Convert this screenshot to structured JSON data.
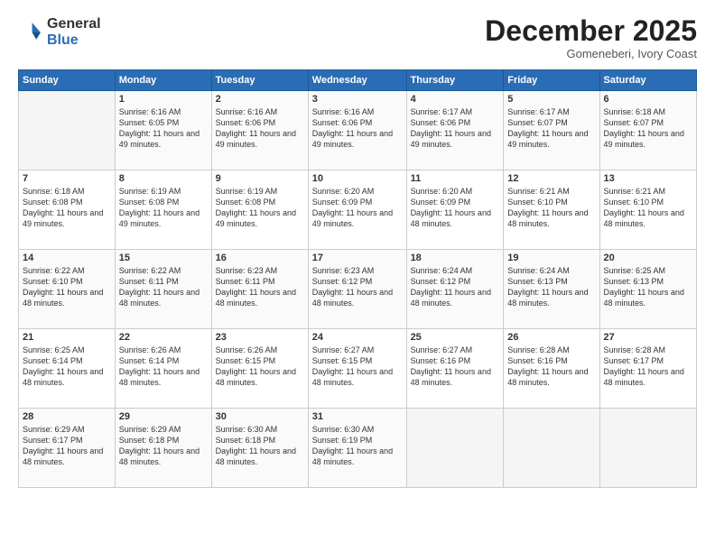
{
  "logo": {
    "general": "General",
    "blue": "Blue"
  },
  "title": {
    "month": "December 2025",
    "location": "Gomeneberi, Ivory Coast"
  },
  "header_days": [
    "Sunday",
    "Monday",
    "Tuesday",
    "Wednesday",
    "Thursday",
    "Friday",
    "Saturday"
  ],
  "weeks": [
    [
      {
        "day": "",
        "empty": true
      },
      {
        "day": "1",
        "sunrise": "Sunrise: 6:16 AM",
        "sunset": "Sunset: 6:05 PM",
        "daylight": "Daylight: 11 hours and 49 minutes."
      },
      {
        "day": "2",
        "sunrise": "Sunrise: 6:16 AM",
        "sunset": "Sunset: 6:06 PM",
        "daylight": "Daylight: 11 hours and 49 minutes."
      },
      {
        "day": "3",
        "sunrise": "Sunrise: 6:16 AM",
        "sunset": "Sunset: 6:06 PM",
        "daylight": "Daylight: 11 hours and 49 minutes."
      },
      {
        "day": "4",
        "sunrise": "Sunrise: 6:17 AM",
        "sunset": "Sunset: 6:06 PM",
        "daylight": "Daylight: 11 hours and 49 minutes."
      },
      {
        "day": "5",
        "sunrise": "Sunrise: 6:17 AM",
        "sunset": "Sunset: 6:07 PM",
        "daylight": "Daylight: 11 hours and 49 minutes."
      },
      {
        "day": "6",
        "sunrise": "Sunrise: 6:18 AM",
        "sunset": "Sunset: 6:07 PM",
        "daylight": "Daylight: 11 hours and 49 minutes."
      }
    ],
    [
      {
        "day": "7",
        "sunrise": "Sunrise: 6:18 AM",
        "sunset": "Sunset: 6:08 PM",
        "daylight": "Daylight: 11 hours and 49 minutes."
      },
      {
        "day": "8",
        "sunrise": "Sunrise: 6:19 AM",
        "sunset": "Sunset: 6:08 PM",
        "daylight": "Daylight: 11 hours and 49 minutes."
      },
      {
        "day": "9",
        "sunrise": "Sunrise: 6:19 AM",
        "sunset": "Sunset: 6:08 PM",
        "daylight": "Daylight: 11 hours and 49 minutes."
      },
      {
        "day": "10",
        "sunrise": "Sunrise: 6:20 AM",
        "sunset": "Sunset: 6:09 PM",
        "daylight": "Daylight: 11 hours and 49 minutes."
      },
      {
        "day": "11",
        "sunrise": "Sunrise: 6:20 AM",
        "sunset": "Sunset: 6:09 PM",
        "daylight": "Daylight: 11 hours and 48 minutes."
      },
      {
        "day": "12",
        "sunrise": "Sunrise: 6:21 AM",
        "sunset": "Sunset: 6:10 PM",
        "daylight": "Daylight: 11 hours and 48 minutes."
      },
      {
        "day": "13",
        "sunrise": "Sunrise: 6:21 AM",
        "sunset": "Sunset: 6:10 PM",
        "daylight": "Daylight: 11 hours and 48 minutes."
      }
    ],
    [
      {
        "day": "14",
        "sunrise": "Sunrise: 6:22 AM",
        "sunset": "Sunset: 6:10 PM",
        "daylight": "Daylight: 11 hours and 48 minutes."
      },
      {
        "day": "15",
        "sunrise": "Sunrise: 6:22 AM",
        "sunset": "Sunset: 6:11 PM",
        "daylight": "Daylight: 11 hours and 48 minutes."
      },
      {
        "day": "16",
        "sunrise": "Sunrise: 6:23 AM",
        "sunset": "Sunset: 6:11 PM",
        "daylight": "Daylight: 11 hours and 48 minutes."
      },
      {
        "day": "17",
        "sunrise": "Sunrise: 6:23 AM",
        "sunset": "Sunset: 6:12 PM",
        "daylight": "Daylight: 11 hours and 48 minutes."
      },
      {
        "day": "18",
        "sunrise": "Sunrise: 6:24 AM",
        "sunset": "Sunset: 6:12 PM",
        "daylight": "Daylight: 11 hours and 48 minutes."
      },
      {
        "day": "19",
        "sunrise": "Sunrise: 6:24 AM",
        "sunset": "Sunset: 6:13 PM",
        "daylight": "Daylight: 11 hours and 48 minutes."
      },
      {
        "day": "20",
        "sunrise": "Sunrise: 6:25 AM",
        "sunset": "Sunset: 6:13 PM",
        "daylight": "Daylight: 11 hours and 48 minutes."
      }
    ],
    [
      {
        "day": "21",
        "sunrise": "Sunrise: 6:25 AM",
        "sunset": "Sunset: 6:14 PM",
        "daylight": "Daylight: 11 hours and 48 minutes."
      },
      {
        "day": "22",
        "sunrise": "Sunrise: 6:26 AM",
        "sunset": "Sunset: 6:14 PM",
        "daylight": "Daylight: 11 hours and 48 minutes."
      },
      {
        "day": "23",
        "sunrise": "Sunrise: 6:26 AM",
        "sunset": "Sunset: 6:15 PM",
        "daylight": "Daylight: 11 hours and 48 minutes."
      },
      {
        "day": "24",
        "sunrise": "Sunrise: 6:27 AM",
        "sunset": "Sunset: 6:15 PM",
        "daylight": "Daylight: 11 hours and 48 minutes."
      },
      {
        "day": "25",
        "sunrise": "Sunrise: 6:27 AM",
        "sunset": "Sunset: 6:16 PM",
        "daylight": "Daylight: 11 hours and 48 minutes."
      },
      {
        "day": "26",
        "sunrise": "Sunrise: 6:28 AM",
        "sunset": "Sunset: 6:16 PM",
        "daylight": "Daylight: 11 hours and 48 minutes."
      },
      {
        "day": "27",
        "sunrise": "Sunrise: 6:28 AM",
        "sunset": "Sunset: 6:17 PM",
        "daylight": "Daylight: 11 hours and 48 minutes."
      }
    ],
    [
      {
        "day": "28",
        "sunrise": "Sunrise: 6:29 AM",
        "sunset": "Sunset: 6:17 PM",
        "daylight": "Daylight: 11 hours and 48 minutes."
      },
      {
        "day": "29",
        "sunrise": "Sunrise: 6:29 AM",
        "sunset": "Sunset: 6:18 PM",
        "daylight": "Daylight: 11 hours and 48 minutes."
      },
      {
        "day": "30",
        "sunrise": "Sunrise: 6:30 AM",
        "sunset": "Sunset: 6:18 PM",
        "daylight": "Daylight: 11 hours and 48 minutes."
      },
      {
        "day": "31",
        "sunrise": "Sunrise: 6:30 AM",
        "sunset": "Sunset: 6:19 PM",
        "daylight": "Daylight: 11 hours and 48 minutes."
      },
      {
        "day": "",
        "empty": true
      },
      {
        "day": "",
        "empty": true
      },
      {
        "day": "",
        "empty": true
      }
    ]
  ]
}
